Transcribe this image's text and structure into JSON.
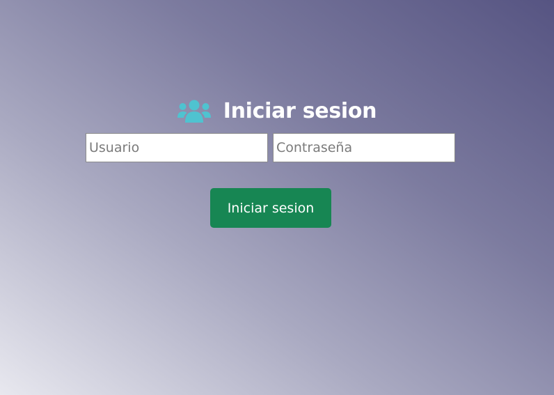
{
  "login": {
    "title": "Iniciar sesion",
    "icon": "users-icon",
    "username_placeholder": "Usuario",
    "username_value": "",
    "password_placeholder": "Contraseña",
    "password_value": "",
    "submit_label": "Iniciar sesion"
  },
  "colors": {
    "icon": "#4fc3d0",
    "button": "#178653",
    "title": "#ffffff"
  }
}
